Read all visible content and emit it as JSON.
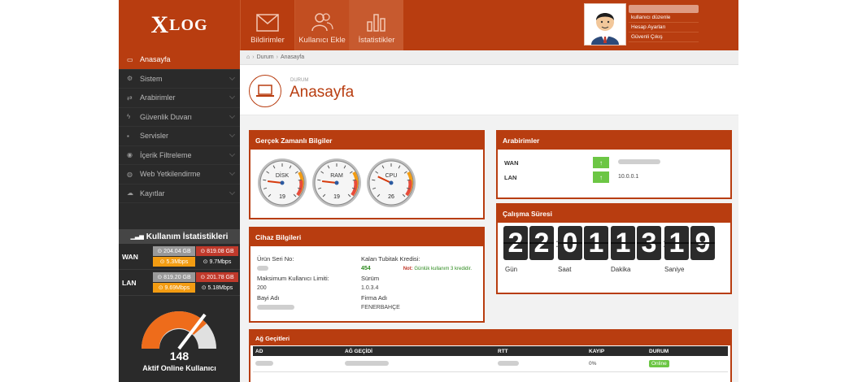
{
  "app": {
    "logo_letter": "X",
    "logo_rest": "LOG"
  },
  "topnav": [
    {
      "label": "Bildirimler",
      "icon": "envelope-icon"
    },
    {
      "label": "Kullanıcı Ekle",
      "icon": "users-icon"
    },
    {
      "label": "İstatistikler",
      "icon": "bar-chart-icon"
    }
  ],
  "user": {
    "menu": [
      "kullanıcı düzenle",
      "Hesap Ayarları",
      "Güvenli Çıkış"
    ]
  },
  "sidebar": {
    "items": [
      {
        "label": "Anasayfa",
        "icon": "laptop-icon",
        "active": true
      },
      {
        "label": "Sistem",
        "icon": "cogs-icon"
      },
      {
        "label": "Arabirimler",
        "icon": "shuffle-icon"
      },
      {
        "label": "Güvenlik Duvarı",
        "icon": "bolt-icon"
      },
      {
        "label": "Servisler",
        "icon": "truck-icon"
      },
      {
        "label": "İçerik Filtreleme",
        "icon": "eye-slash-icon"
      },
      {
        "label": "Web Yetkilendirme",
        "icon": "globe-icon"
      },
      {
        "label": "Kayıtlar",
        "icon": "cloud-icon"
      }
    ],
    "stats_title": "Kullanım İstatistikleri",
    "stats": [
      {
        "name": "WAN",
        "down_total": "204.04 GB",
        "up_total": "819.08 GB",
        "down_rate": "5.3Mbps",
        "up_rate": "9.7Mbps"
      },
      {
        "name": "LAN",
        "down_total": "819.20 GB",
        "up_total": "201.78 GB",
        "down_rate": "9.69Mbps",
        "up_rate": "5.18Mbps"
      }
    ],
    "online_count": "148",
    "online_label": "Aktif Online Kullanıcı"
  },
  "breadcrumb": [
    "Durum",
    "Anasayfa"
  ],
  "page": {
    "subtitle": "DURUM",
    "title": "Anasayfa"
  },
  "realtime": {
    "title": "Gerçek Zamanlı Bilgiler",
    "gauges": [
      {
        "label": "DİSK",
        "value": "19"
      },
      {
        "label": "RAM",
        "value": "19"
      },
      {
        "label": "CPU",
        "value": "26"
      }
    ]
  },
  "device": {
    "title": "Cihaz Bilgileri",
    "serial_label": "Ürün Seri No:",
    "max_users_label": "Maksimum Kullanıcı Limiti:",
    "max_users_value": "200",
    "dealer_label": "Bayi Adı",
    "credit_label": "Kalan Tubitak Kredisi:",
    "credit_value": "454",
    "note_prefix": "Not:",
    "note_text": "Günlük kullanım 3 kredidir.",
    "version_label": "Sürüm",
    "version_value": "1.0.3.4",
    "company_label": "Firma Adı",
    "company_value": "FENERBAHÇE"
  },
  "interfaces": {
    "title": "Arabirimler",
    "rows": [
      {
        "name": "WAN",
        "value": ""
      },
      {
        "name": "LAN",
        "value": "10.0.0.1"
      }
    ]
  },
  "uptime": {
    "title": "Çalışma Süresi",
    "days": "22",
    "hours": "01",
    "minutes": "13",
    "seconds": "19",
    "labels": [
      "Gün",
      "Saat",
      "Dakika",
      "Saniye"
    ]
  },
  "gateways": {
    "title": "Ağ Geçitleri",
    "columns": [
      "AD",
      "AĞ GEÇİDİ",
      "RTT",
      "KAYIP",
      "DURUM"
    ],
    "rows": [
      {
        "loss": "0%",
        "status": "Online"
      }
    ]
  },
  "colors": {
    "brand": "#b83d10",
    "online": "#6cc644",
    "dark": "#2a2a2a"
  }
}
